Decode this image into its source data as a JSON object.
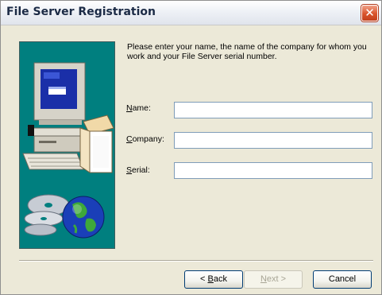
{
  "window": {
    "title": "File Server Registration",
    "close_glyph": "✕"
  },
  "instructions": "Please enter your name, the name of the company for whom you work and your File Server serial number.",
  "fields": {
    "name": {
      "label_key": "N",
      "label_rest": "ame:",
      "value": ""
    },
    "company": {
      "label_key": "C",
      "label_rest": "ompany:",
      "value": ""
    },
    "serial": {
      "label_key": "S",
      "label_rest": "erial:",
      "value": ""
    }
  },
  "buttons": {
    "back": {
      "prefix": "< ",
      "key": "B",
      "rest": "ack",
      "enabled": true
    },
    "next": {
      "key": "N",
      "rest": "ext",
      "suffix": " >",
      "enabled": false
    },
    "cancel": {
      "label": "Cancel",
      "enabled": true
    }
  },
  "art": {
    "background_color": "#007f7f",
    "icons": [
      "computer-monitor-icon",
      "box-icon",
      "cd-discs-icon",
      "globe-icon"
    ]
  }
}
